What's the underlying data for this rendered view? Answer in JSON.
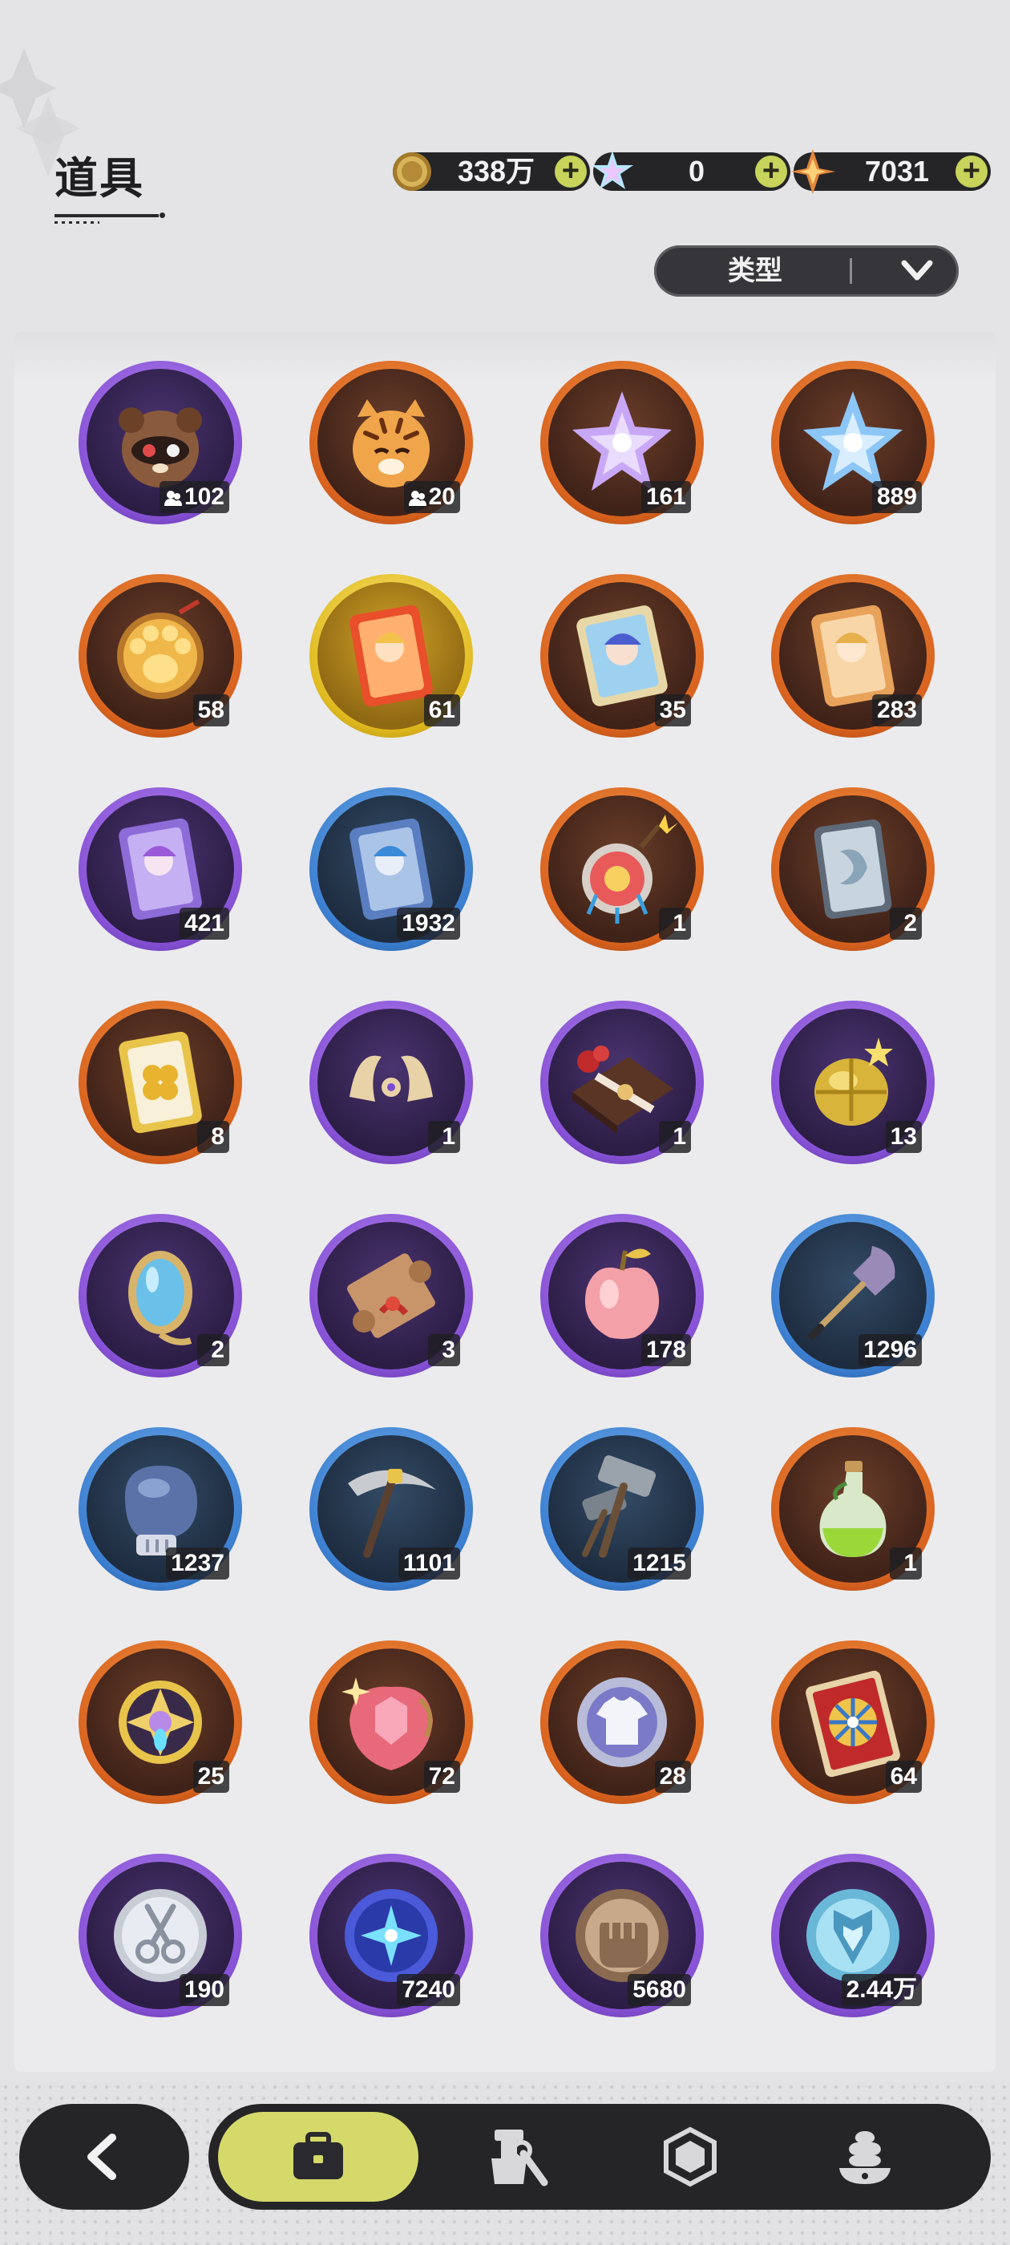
{
  "header": {
    "title": "道具"
  },
  "currencies": [
    {
      "name": "gold-coin",
      "value": "338万",
      "color": "#c9a24a"
    },
    {
      "name": "crystal",
      "value": "0",
      "color": "#9fd8ff"
    },
    {
      "name": "star-gem",
      "value": "7031",
      "color": "#f0a040"
    }
  ],
  "filter": {
    "label": "类型"
  },
  "items": [
    {
      "icon": "tanuki-friend-icon",
      "count": "102",
      "rarity": "purple",
      "friend": true
    },
    {
      "icon": "tiger-friend-icon",
      "count": "20",
      "rarity": "orange",
      "friend": true
    },
    {
      "icon": "purple-crystal-icon",
      "count": "161",
      "rarity": "orange"
    },
    {
      "icon": "blue-crystal-icon",
      "count": "889",
      "rarity": "orange"
    },
    {
      "icon": "paw-charm-icon",
      "count": "58",
      "rarity": "orange"
    },
    {
      "icon": "gold-character-card-icon",
      "count": "61",
      "rarity": "gold"
    },
    {
      "icon": "holo-character-card-icon",
      "count": "35",
      "rarity": "orange"
    },
    {
      "icon": "orange-character-card-icon",
      "count": "283",
      "rarity": "orange"
    },
    {
      "icon": "purple-character-card-icon",
      "count": "421",
      "rarity": "purple"
    },
    {
      "icon": "blue-character-card-icon",
      "count": "1932",
      "rarity": "blue"
    },
    {
      "icon": "firework-bomb-icon",
      "count": "1",
      "rarity": "orange"
    },
    {
      "icon": "silver-card-icon",
      "count": "2",
      "rarity": "orange"
    },
    {
      "icon": "clover-card-icon",
      "count": "8",
      "rarity": "orange"
    },
    {
      "icon": "horn-ornament-icon",
      "count": "1",
      "rarity": "purple"
    },
    {
      "icon": "chocolate-box-icon",
      "count": "1",
      "rarity": "purple"
    },
    {
      "icon": "golden-egg-icon",
      "count": "13",
      "rarity": "purple"
    },
    {
      "icon": "magic-mirror-icon",
      "count": "2",
      "rarity": "purple"
    },
    {
      "icon": "scroll-icon",
      "count": "3",
      "rarity": "purple"
    },
    {
      "icon": "golden-apple-icon",
      "count": "178",
      "rarity": "purple"
    },
    {
      "icon": "shovel-icon",
      "count": "1296",
      "rarity": "blue"
    },
    {
      "icon": "boxing-glove-icon",
      "count": "1237",
      "rarity": "blue"
    },
    {
      "icon": "pickaxe-icon",
      "count": "1101",
      "rarity": "blue"
    },
    {
      "icon": "hammer-icon",
      "count": "1215",
      "rarity": "blue"
    },
    {
      "icon": "potion-icon",
      "count": "1",
      "rarity": "orange"
    },
    {
      "icon": "emblem-badge-icon",
      "count": "25",
      "rarity": "orange"
    },
    {
      "icon": "pink-gem-icon",
      "count": "72",
      "rarity": "orange"
    },
    {
      "icon": "shirt-token-icon",
      "count": "28",
      "rarity": "orange"
    },
    {
      "icon": "wheel-ticket-icon",
      "count": "64",
      "rarity": "orange"
    },
    {
      "icon": "scissors-coin-icon",
      "count": "190",
      "rarity": "purple"
    },
    {
      "icon": "star-coin-icon",
      "count": "7240",
      "rarity": "purple"
    },
    {
      "icon": "fist-coin-icon",
      "count": "5680",
      "rarity": "purple"
    },
    {
      "icon": "crest-coin-icon",
      "count": "2.44万",
      "rarity": "purple"
    }
  ],
  "nav": {
    "back": "back-arrow-icon",
    "tabs": [
      {
        "icon": "briefcase-icon",
        "active": true
      },
      {
        "icon": "tools-icon",
        "active": false
      },
      {
        "icon": "hexagon-gem-icon",
        "active": false
      },
      {
        "icon": "dessert-icon",
        "active": false
      }
    ]
  }
}
